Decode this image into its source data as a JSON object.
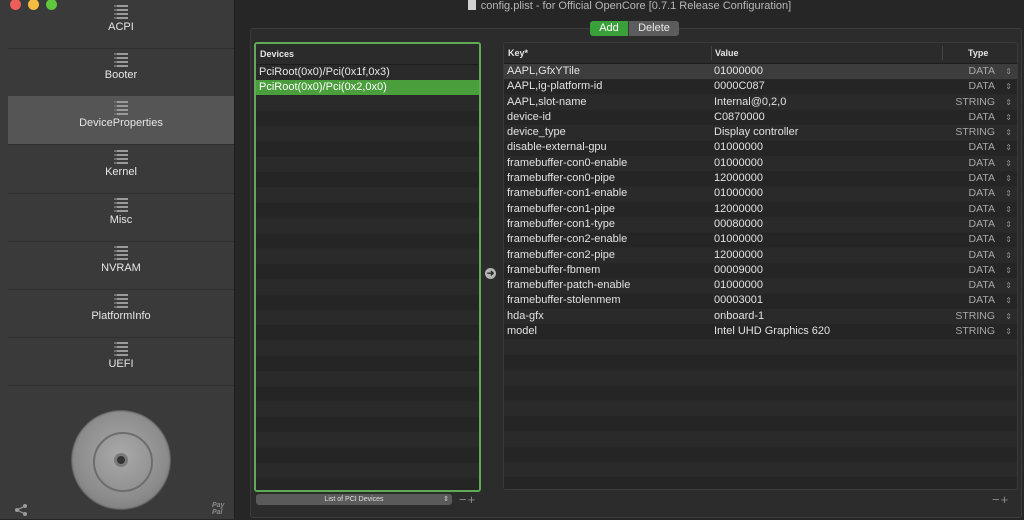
{
  "window": {
    "title": "config.plist - for Official OpenCore [0.7.1 Release Configuration]"
  },
  "sidebar": {
    "items": [
      {
        "label": "ACPI",
        "active": false
      },
      {
        "label": "Booter",
        "active": false
      },
      {
        "label": "DeviceProperties",
        "active": true
      },
      {
        "label": "Kernel",
        "active": false
      },
      {
        "label": "Misc",
        "active": false
      },
      {
        "label": "NVRAM",
        "active": false
      },
      {
        "label": "PlatformInfo",
        "active": false
      },
      {
        "label": "UEFI",
        "active": false
      }
    ],
    "paypal_label": "Pay Pal"
  },
  "toolbar": {
    "add_label": "Add",
    "delete_label": "Delete"
  },
  "devices": {
    "header": "Devices",
    "items": [
      {
        "label": "PciRoot(0x0)/Pci(0x1f,0x3)",
        "selected": false
      },
      {
        "label": "PciRoot(0x0)/Pci(0x2,0x0)",
        "selected": true
      }
    ],
    "select_value": "List of PCI Devices",
    "plus_minus": "−+"
  },
  "properties": {
    "columns": {
      "key": "Key*",
      "value": "Value",
      "type": "Type"
    },
    "rows": [
      {
        "key": "AAPL,GfxYTile",
        "value": "01000000",
        "type": "DATA"
      },
      {
        "key": "AAPL,ig-platform-id",
        "value": "0000C087",
        "type": "DATA"
      },
      {
        "key": "AAPL,slot-name",
        "value": "Internal@0,2,0",
        "type": "STRING"
      },
      {
        "key": "device-id",
        "value": "C0870000",
        "type": "DATA"
      },
      {
        "key": "device_type",
        "value": "Display controller",
        "type": "STRING"
      },
      {
        "key": "disable-external-gpu",
        "value": "01000000",
        "type": "DATA"
      },
      {
        "key": "framebuffer-con0-enable",
        "value": "01000000",
        "type": "DATA"
      },
      {
        "key": "framebuffer-con0-pipe",
        "value": "12000000",
        "type": "DATA"
      },
      {
        "key": "framebuffer-con1-enable",
        "value": "01000000",
        "type": "DATA"
      },
      {
        "key": "framebuffer-con1-pipe",
        "value": "12000000",
        "type": "DATA"
      },
      {
        "key": "framebuffer-con1-type",
        "value": "00080000",
        "type": "DATA"
      },
      {
        "key": "framebuffer-con2-enable",
        "value": "01000000",
        "type": "DATA"
      },
      {
        "key": "framebuffer-con2-pipe",
        "value": "12000000",
        "type": "DATA"
      },
      {
        "key": "framebuffer-fbmem",
        "value": "00009000",
        "type": "DATA"
      },
      {
        "key": "framebuffer-patch-enable",
        "value": "01000000",
        "type": "DATA"
      },
      {
        "key": "framebuffer-stolenmem",
        "value": "00003001",
        "type": "DATA"
      },
      {
        "key": "hda-gfx",
        "value": "onboard-1",
        "type": "STRING"
      },
      {
        "key": "model",
        "value": "Intel UHD Graphics 620",
        "type": "STRING"
      }
    ],
    "plus_minus": "−+"
  }
}
